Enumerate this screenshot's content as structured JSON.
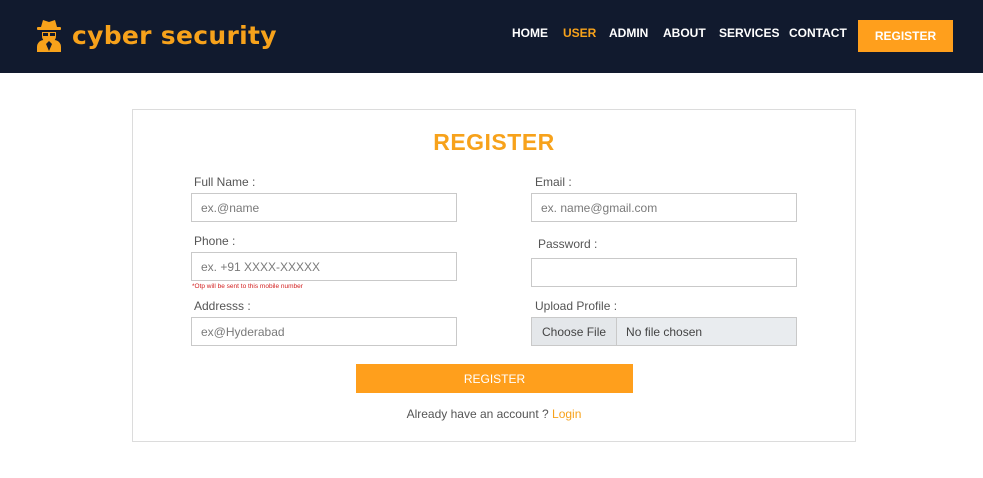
{
  "brand": {
    "name": "cyber security",
    "icon": "spy-icon",
    "color": "#f7a21b"
  },
  "nav": {
    "items": [
      {
        "label": "HOME"
      },
      {
        "label": "USER",
        "active": true
      },
      {
        "label": "ADMIN"
      },
      {
        "label": "ABOUT"
      },
      {
        "label": "SERVICES"
      },
      {
        "label": "CONTACT"
      }
    ],
    "register_label": "REGISTER"
  },
  "form": {
    "title": "REGISTER",
    "full_name": {
      "label": "Full Name :",
      "placeholder": "ex.@name"
    },
    "email": {
      "label": "Email :",
      "placeholder": "ex. name@gmail.com"
    },
    "phone": {
      "label": "Phone :",
      "placeholder": "ex. +91 XXXX-XXXXX",
      "note": "*Otp will be sent to this mobile number"
    },
    "password": {
      "label": "Password :",
      "placeholder": ""
    },
    "address": {
      "label": "Addresss :",
      "placeholder": "ex@Hyderabad"
    },
    "upload": {
      "label": "Upload Profile :",
      "button": "Choose File",
      "status": "No file chosen"
    },
    "submit_label": "REGISTER",
    "login_prompt": "Already have an account ?",
    "login_link": "Login"
  },
  "colors": {
    "navbar_bg": "#111a2e",
    "accent": "#f7a21b",
    "button": "#ff9f1c"
  }
}
